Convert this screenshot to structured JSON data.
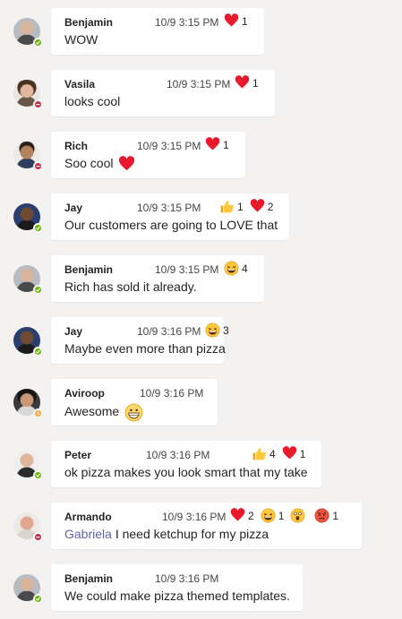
{
  "colors": {
    "background": "#f3f2f1",
    "bubble": "#ffffff",
    "mention": "#6264a7",
    "available": "#6bb700",
    "busy": "#c4314b",
    "away": "#ffaa44"
  },
  "messages": [
    {
      "author": "Benjamin",
      "time": "10/9 3:15 PM",
      "text": "WOW",
      "status": "available",
      "reactions": [
        {
          "icon": "heart-icon",
          "count": "1"
        }
      ]
    },
    {
      "author": "Vasila",
      "time": "10/9 3:15 PM",
      "text": "looks cool",
      "status": "busy",
      "reactions": [
        {
          "icon": "heart-icon",
          "count": "1"
        }
      ]
    },
    {
      "author": "Rich",
      "time": "10/9 3:15 PM",
      "text": "Soo cool",
      "status": "busy",
      "inline_emoji": "heart-icon",
      "reactions": [
        {
          "icon": "heart-icon",
          "count": "1"
        }
      ]
    },
    {
      "author": "Jay",
      "time": "10/9 3:15 PM",
      "text": "Our customers are going to LOVE that",
      "status": "available",
      "reactions": [
        {
          "icon": "thumbs-up-icon",
          "count": "1"
        },
        {
          "icon": "heart-icon",
          "count": "2"
        }
      ]
    },
    {
      "author": "Benjamin",
      "time": "10/9 3:15 PM",
      "text": "Rich has sold it already.",
      "status": "available",
      "reactions": [
        {
          "icon": "laughing-face-icon",
          "count": "4"
        }
      ]
    },
    {
      "author": "Jay",
      "time": "10/9 3:16 PM",
      "text": "Maybe even more than pizza",
      "status": "available",
      "reactions": [
        {
          "icon": "laughing-face-icon",
          "count": "3"
        }
      ]
    },
    {
      "author": "Aviroop",
      "time": "10/9 3:16 PM",
      "text": "Awesome",
      "status": "away",
      "inline_emoji": "grinning-face-icon",
      "reactions": []
    },
    {
      "author": "Peter",
      "time": "10/9 3:16 PM",
      "text": "ok pizza makes you look smart that my take",
      "status": "available",
      "reactions": [
        {
          "icon": "thumbs-up-icon",
          "count": "4"
        },
        {
          "icon": "heart-icon",
          "count": "1"
        }
      ]
    },
    {
      "author": "Armando",
      "time": "10/9 3:16 PM",
      "mention": "Gabriela",
      "text": "I need ketchup for my pizza",
      "status": "busy",
      "reactions": [
        {
          "icon": "heart-icon",
          "count": "2"
        },
        {
          "icon": "laughing-face-icon",
          "count": "1"
        },
        {
          "icon": "surprised-face-icon",
          "count": ""
        },
        {
          "icon": "angry-face-icon",
          "count": "1"
        }
      ]
    },
    {
      "author": "Benjamin",
      "time": "10/9 3:16 PM",
      "text": "We could make pizza themed templates.",
      "status": "available",
      "reactions": []
    }
  ]
}
